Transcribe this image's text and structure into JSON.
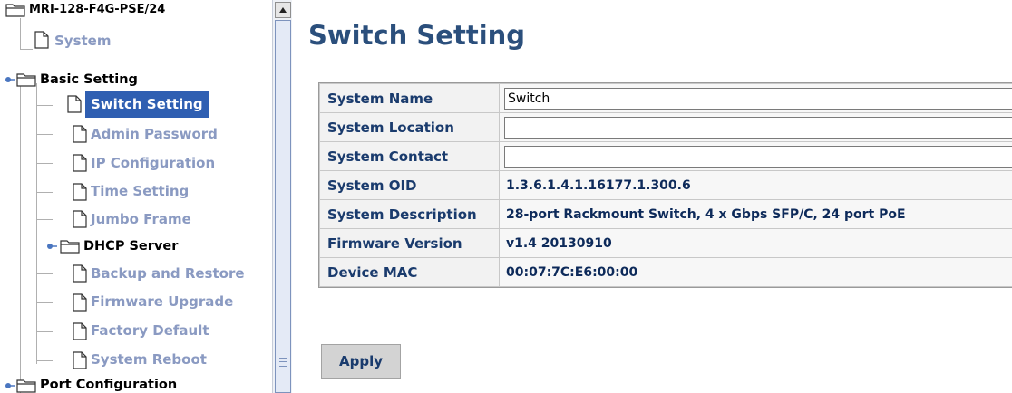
{
  "sidebar": {
    "root_label": "MRI-128-F4G-PSE/24",
    "items": [
      {
        "label": "System",
        "type": "page"
      },
      {
        "label": "Basic Setting",
        "type": "folder"
      },
      {
        "label": "Switch Setting",
        "type": "page",
        "selected": true
      },
      {
        "label": "Admin Password",
        "type": "page"
      },
      {
        "label": "IP Configuration",
        "type": "page"
      },
      {
        "label": "Time Setting",
        "type": "page"
      },
      {
        "label": "Jumbo Frame",
        "type": "page"
      },
      {
        "label": "DHCP Server",
        "type": "folder"
      },
      {
        "label": "Backup and Restore",
        "type": "page"
      },
      {
        "label": "Firmware Upgrade",
        "type": "page"
      },
      {
        "label": "Factory Default",
        "type": "page"
      },
      {
        "label": "System Reboot",
        "type": "page"
      },
      {
        "label": "Port Configuration",
        "type": "folder"
      }
    ]
  },
  "main": {
    "title": "Switch Setting",
    "rows": [
      {
        "label": "System Name",
        "value": "Switch",
        "kind": "input"
      },
      {
        "label": "System Location",
        "value": "",
        "kind": "input"
      },
      {
        "label": "System Contact",
        "value": "",
        "kind": "input"
      },
      {
        "label": "System OID",
        "value": "1.3.6.1.4.1.16177.1.300.6",
        "kind": "text"
      },
      {
        "label": "System Description",
        "value": "28-port Rackmount Switch, 4 x Gbps SFP/C, 24 port PoE",
        "kind": "text"
      },
      {
        "label": "Firmware Version",
        "value": "v1.4 20130910",
        "kind": "text"
      },
      {
        "label": "Device MAC",
        "value": "00:07:7C:E6:00:00",
        "kind": "text"
      }
    ],
    "apply_label": "Apply"
  },
  "colors": {
    "selected_bg": "#2f5fb2",
    "link_text": "#8a9ac2",
    "title_text": "#2b4f7c",
    "label_text": "#1a3b6d"
  }
}
